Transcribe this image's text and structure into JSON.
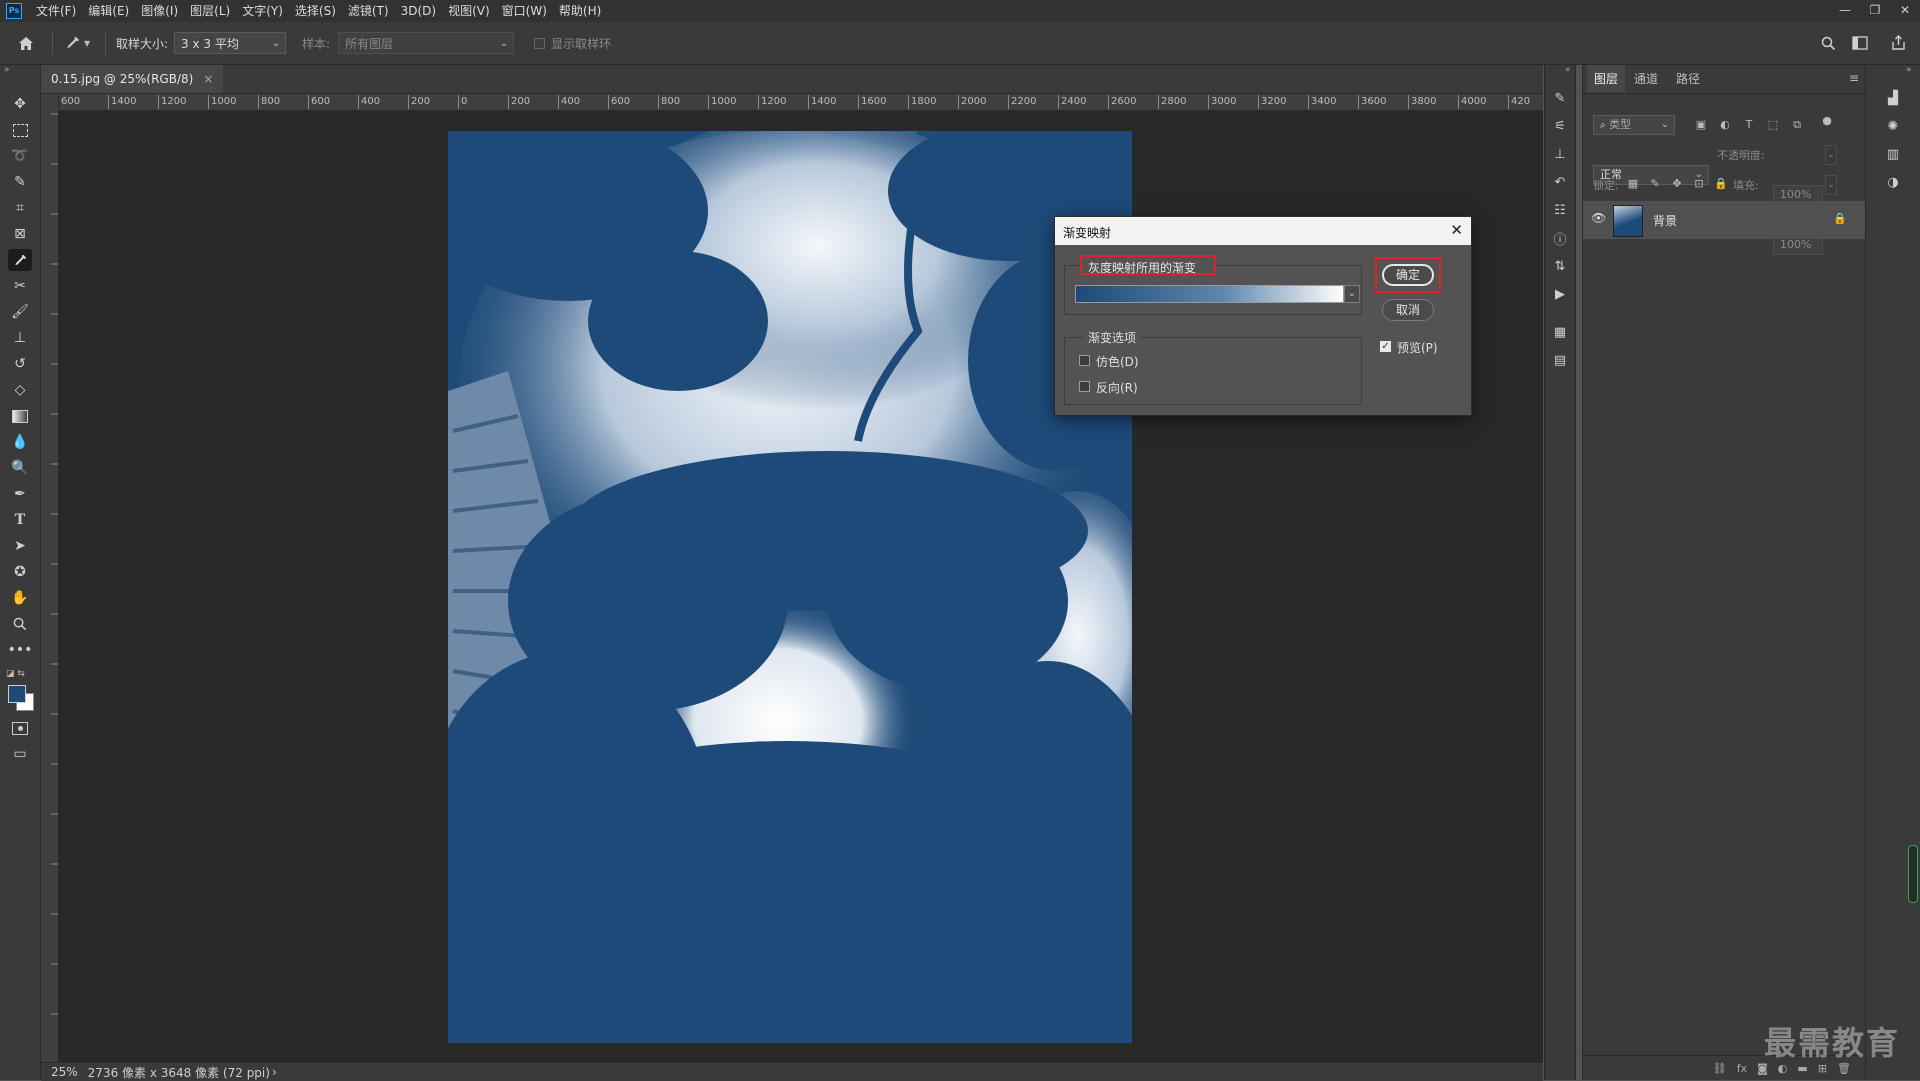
{
  "app": {
    "logo": "Ps"
  },
  "menu": [
    "文件(F)",
    "编辑(E)",
    "图像(I)",
    "图层(L)",
    "文字(Y)",
    "选择(S)",
    "滤镜(T)",
    "3D(D)",
    "视图(V)",
    "窗口(W)",
    "帮助(H)"
  ],
  "options": {
    "sample_size_label": "取样大小:",
    "sample_size_value": "3 x 3 平均",
    "sample_label": "样本:",
    "sample_value": "所有图层",
    "show_ring_label": "显示取样环"
  },
  "document": {
    "tab_title": "0.15.jpg @ 25%(RGB/8)",
    "close_glyph": "×",
    "zoom": "25%",
    "dimensions": "2736 像素 x 3648 像素 (72 ppi)",
    "status_caret": "›"
  },
  "ruler": {
    "h_ticks": [
      "600",
      "1400",
      "1200",
      "1000",
      "800",
      "600",
      "400",
      "200",
      "0",
      "200",
      "400",
      "600",
      "800",
      "1000",
      "1200",
      "1400",
      "1600",
      "1800",
      "2000",
      "2200",
      "2400",
      "2600",
      "2800",
      "3000",
      "3200",
      "3400",
      "3600",
      "3800",
      "4000",
      "420"
    ]
  },
  "dialog": {
    "title": "渐变映射",
    "gradient_group_label": "灰度映射所用的渐变",
    "options_group_label": "渐变选项",
    "dither_label": "仿色(D)",
    "reverse_label": "反向(R)",
    "ok_label": "确定",
    "cancel_label": "取消",
    "preview_label": "预览(P)",
    "preview_checked": true,
    "dither_checked": false,
    "reverse_checked": false,
    "gradient_start_color": "#1d4a78",
    "gradient_end_color": "#ffffff"
  },
  "panels": {
    "tabs": [
      "图层",
      "通道",
      "路径"
    ],
    "filter_placeholder": "类型",
    "blend_mode": "正常",
    "opacity_label": "不透明度:",
    "opacity_value": "100%",
    "lock_label": "锁定:",
    "fill_label": "填充:",
    "fill_value": "100%",
    "layers": [
      {
        "name": "背景",
        "visible": true,
        "locked": true
      }
    ]
  },
  "watermark": "最需教育",
  "colors": {
    "foreground": "#1d4a78",
    "background": "#ffffff",
    "accent_red": "#e0232b"
  }
}
